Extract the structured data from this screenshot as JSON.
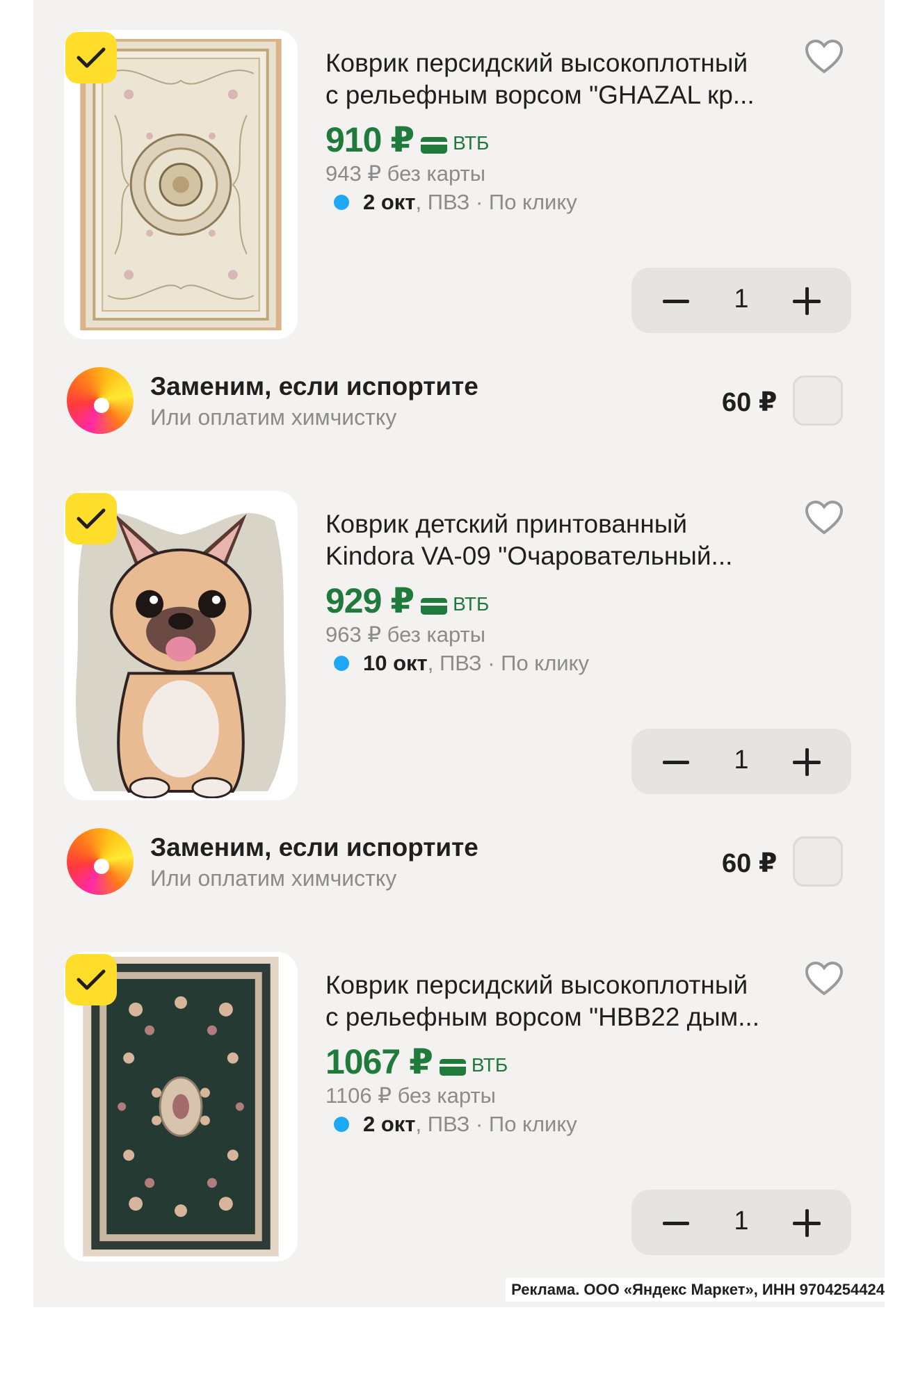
{
  "items": [
    {
      "title_line1": "Коврик персидский высокоплотный",
      "title_line2": "с рельефным ворсом \"GHAZAL кр...",
      "price": "910 ₽",
      "bank": "ВТБ",
      "old_price": "943 ₽  без карты",
      "delivery_date": "2 окт",
      "delivery_rest": ", ПВЗ · По клику",
      "quantity": "1",
      "checked": true,
      "image": "persian-rug-beige-icon"
    },
    {
      "title_line1": "Коврик детский принтованный",
      "title_line2": "Kindora VA-09 \"Очаровательный...",
      "price": "929 ₽",
      "bank": "ВТБ",
      "old_price": "963 ₽  без карты",
      "delivery_date": "10 окт",
      "delivery_rest": ", ПВЗ · По клику",
      "quantity": "1",
      "checked": true,
      "image": "french-bulldog-rug-icon"
    },
    {
      "title_line1": "Коврик персидский высокоплотный",
      "title_line2": "с рельефным ворсом \"HBB22 дым...",
      "price": "1067 ₽",
      "bank": "ВТБ",
      "old_price": "1106 ₽  без карты",
      "delivery_date": "2 окт",
      "delivery_rest": ", ПВЗ · По клику",
      "quantity": "1",
      "checked": true,
      "image": "persian-rug-dark-icon"
    }
  ],
  "service": {
    "title": "Заменим, если испортите",
    "subtitle": "Или оплатим химчистку",
    "price": "60 ₽"
  },
  "footer": "Реклама. ООО «Яндекс Маркет», ИНН 9704254424",
  "colors": {
    "price_green": "#1f7a3c",
    "check_yellow": "#ffde2b",
    "dot_blue": "#1ea7f3"
  }
}
